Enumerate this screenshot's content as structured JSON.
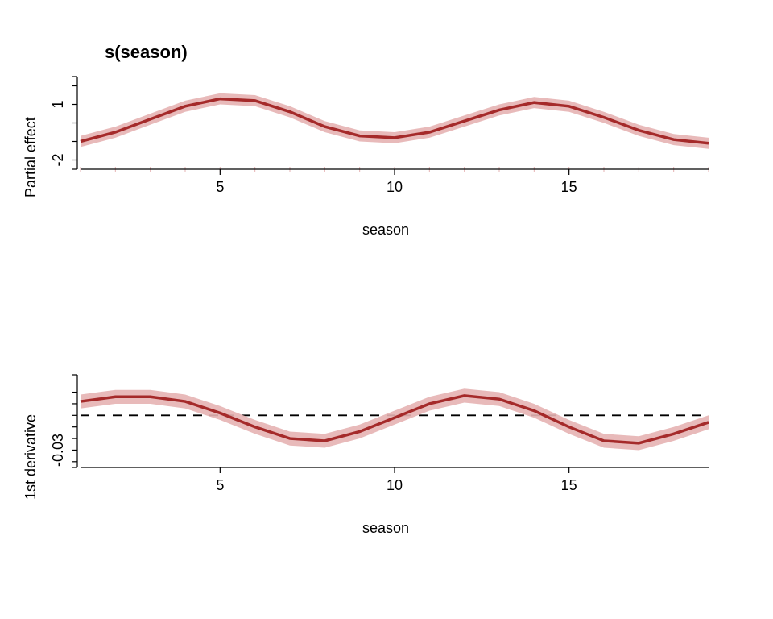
{
  "subtitle": "s(season)",
  "colors": {
    "line": "#A52A2A",
    "ribbon": "#E6B3B3",
    "axis": "#000000",
    "reference": "#000000",
    "background": "#FFFFFF"
  },
  "chart_data": [
    {
      "type": "line",
      "id": "partial-effect",
      "title": "s(season)",
      "xlabel": "season",
      "ylabel": "Partial effect",
      "xlim": [
        1,
        19
      ],
      "ylim": [
        -2.5,
        2.5
      ],
      "x_ticks": [
        5,
        10,
        15
      ],
      "y_ticks": [
        -2,
        1
      ],
      "series": [
        {
          "name": "fit",
          "x": [
            1,
            2,
            3,
            4,
            5,
            6,
            7,
            8,
            9,
            10,
            11,
            12,
            13,
            14,
            15,
            16,
            17,
            18,
            19
          ],
          "values": [
            -1.0,
            -0.5,
            0.2,
            0.9,
            1.3,
            1.2,
            0.6,
            -0.2,
            -0.7,
            -0.8,
            -0.5,
            0.1,
            0.7,
            1.1,
            0.9,
            0.3,
            -0.4,
            -0.9,
            -1.1
          ]
        },
        {
          "name": "lower",
          "x": [
            1,
            2,
            3,
            4,
            5,
            6,
            7,
            8,
            9,
            10,
            11,
            12,
            13,
            14,
            15,
            16,
            17,
            18,
            19
          ],
          "values": [
            -1.3,
            -0.8,
            -0.1,
            0.6,
            1.0,
            0.9,
            0.3,
            -0.5,
            -1.0,
            -1.1,
            -0.8,
            -0.2,
            0.4,
            0.8,
            0.6,
            0.0,
            -0.7,
            -1.2,
            -1.4
          ]
        },
        {
          "name": "upper",
          "x": [
            1,
            2,
            3,
            4,
            5,
            6,
            7,
            8,
            9,
            10,
            11,
            12,
            13,
            14,
            15,
            16,
            17,
            18,
            19
          ],
          "values": [
            -0.7,
            -0.2,
            0.5,
            1.2,
            1.6,
            1.5,
            0.9,
            0.1,
            -0.4,
            -0.5,
            -0.2,
            0.4,
            1.0,
            1.4,
            1.2,
            0.6,
            -0.1,
            -0.6,
            -0.8
          ]
        }
      ]
    },
    {
      "type": "line",
      "id": "first-derivative",
      "xlabel": "season",
      "ylabel": "1st derivative",
      "xlim": [
        1,
        19
      ],
      "ylim": [
        -0.045,
        0.035
      ],
      "x_ticks": [
        5,
        10,
        15
      ],
      "y_ticks": [
        -0.03
      ],
      "hline": 0,
      "series": [
        {
          "name": "fit",
          "x": [
            1,
            2,
            3,
            4,
            5,
            6,
            7,
            8,
            9,
            10,
            11,
            12,
            13,
            14,
            15,
            16,
            17,
            18,
            19
          ],
          "values": [
            0.012,
            0.016,
            0.016,
            0.012,
            0.002,
            -0.01,
            -0.02,
            -0.022,
            -0.014,
            -0.002,
            0.01,
            0.017,
            0.014,
            0.004,
            -0.01,
            -0.022,
            -0.024,
            -0.016,
            -0.006
          ]
        },
        {
          "name": "lower",
          "x": [
            1,
            2,
            3,
            4,
            5,
            6,
            7,
            8,
            9,
            10,
            11,
            12,
            13,
            14,
            15,
            16,
            17,
            18,
            19
          ],
          "values": [
            0.006,
            0.01,
            0.01,
            0.006,
            -0.004,
            -0.016,
            -0.026,
            -0.028,
            -0.02,
            -0.008,
            0.004,
            0.011,
            0.008,
            -0.002,
            -0.016,
            -0.028,
            -0.03,
            -0.022,
            -0.012
          ]
        },
        {
          "name": "upper",
          "x": [
            1,
            2,
            3,
            4,
            5,
            6,
            7,
            8,
            9,
            10,
            11,
            12,
            13,
            14,
            15,
            16,
            17,
            18,
            19
          ],
          "values": [
            0.018,
            0.022,
            0.022,
            0.018,
            0.008,
            -0.004,
            -0.014,
            -0.016,
            -0.008,
            0.004,
            0.016,
            0.023,
            0.02,
            0.01,
            -0.004,
            -0.016,
            -0.018,
            -0.01,
            0.0
          ]
        }
      ]
    }
  ]
}
